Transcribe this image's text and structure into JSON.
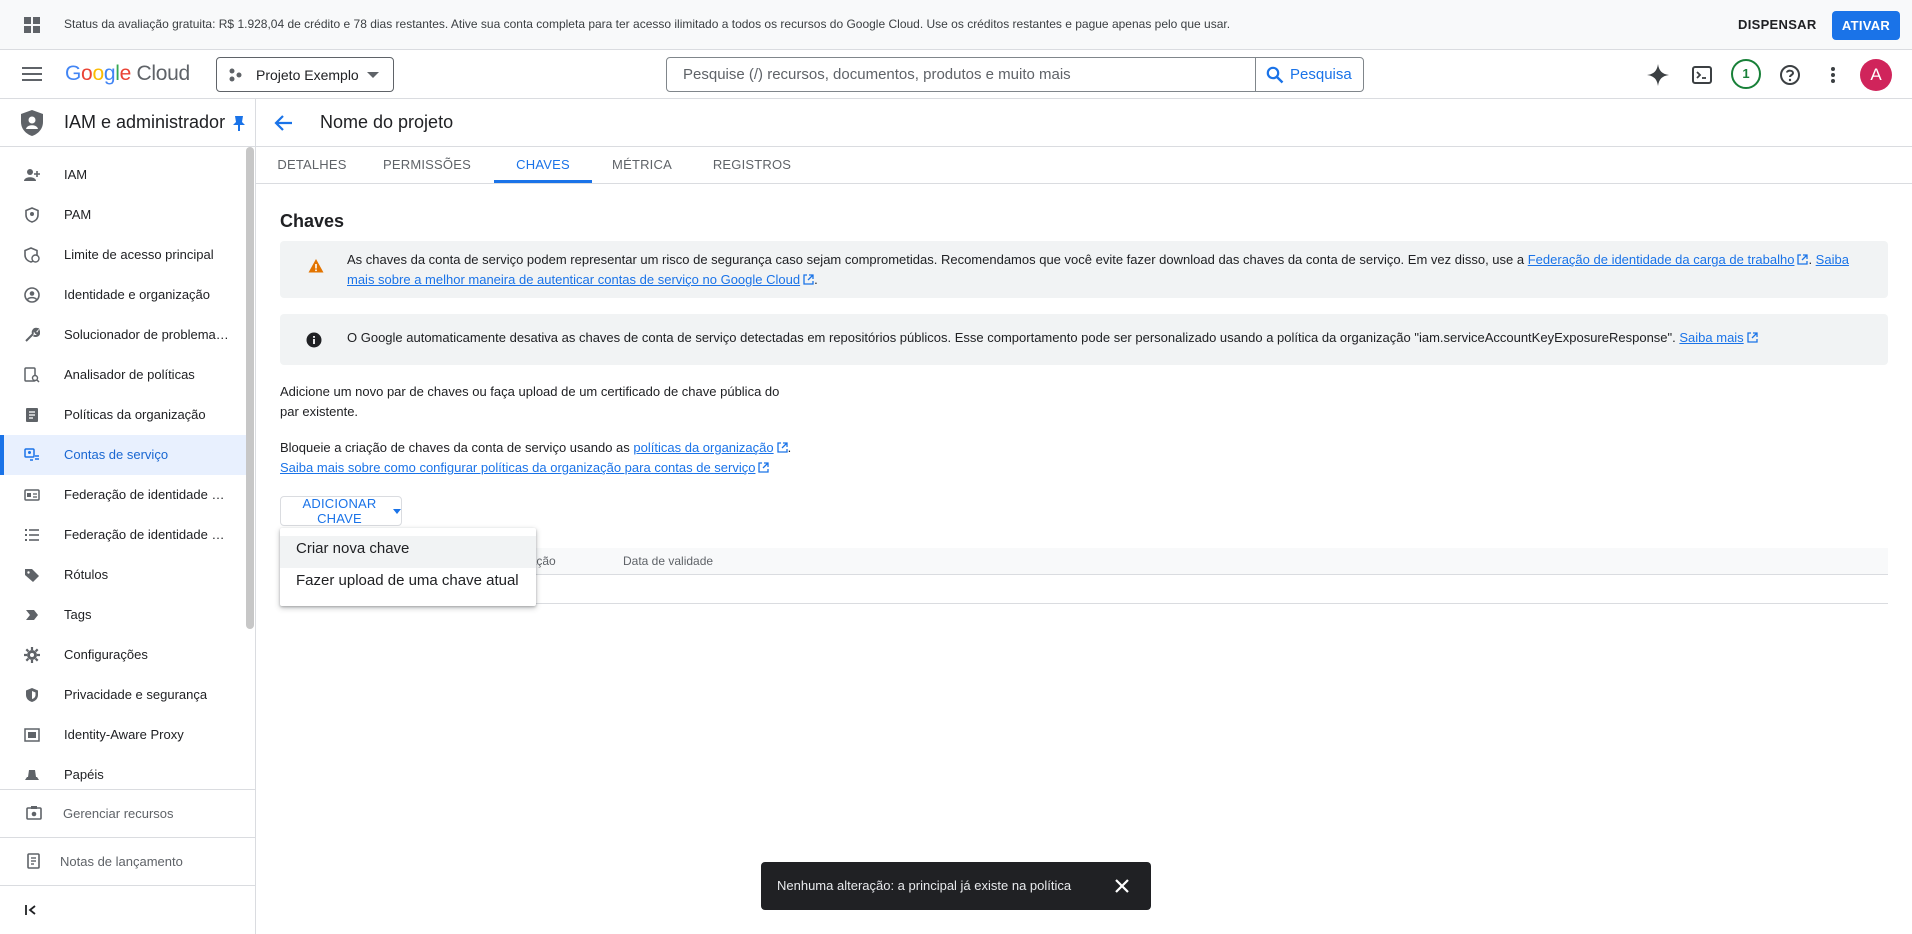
{
  "banner": {
    "text": "Status da avaliação gratuita: R$ 1.928,04 de crédito e 78 dias restantes. Ative sua conta completa para ter acesso ilimitado a todos os recursos do Google Cloud. Use os créditos restantes e pague apenas pelo que usar.",
    "dismiss_label": "DISPENSAR",
    "activate_label": "ATIVAR"
  },
  "header": {
    "logo_google": "Google",
    "logo_cloud": "Cloud",
    "project_name": "Projeto Exemplo",
    "search_placeholder": "Pesquise (/) recursos, documentos, produtos e muito mais",
    "search_button": "Pesquisa",
    "notification_count": "1",
    "avatar_initial": "A"
  },
  "sidebar": {
    "title": "IAM e administrador",
    "items": [
      {
        "label": "IAM",
        "icon": "person-add-icon"
      },
      {
        "label": "PAM",
        "icon": "shield-key-icon"
      },
      {
        "label": "Limite de acesso principal",
        "icon": "shield-clock-icon"
      },
      {
        "label": "Identidade e organização",
        "icon": "account-circle-icon"
      },
      {
        "label": "Solucionador de problemas de política",
        "icon": "wrench-icon"
      },
      {
        "label": "Analisador de políticas",
        "icon": "policy-search-icon"
      },
      {
        "label": "Políticas da organização",
        "icon": "document-icon"
      },
      {
        "label": "Contas de serviço",
        "icon": "service-account-icon",
        "active": true
      },
      {
        "label": "Federação de identidade da carga de trabalho",
        "icon": "id-card-icon"
      },
      {
        "label": "Federação de identidade da força de trabalho",
        "icon": "list-icon"
      },
      {
        "label": "Rótulos",
        "icon": "label-icon"
      },
      {
        "label": "Tags",
        "icon": "tag-arrow-icon"
      },
      {
        "label": "Configurações",
        "icon": "gear-icon"
      },
      {
        "label": "Privacidade e segurança",
        "icon": "privacy-shield-icon"
      },
      {
        "label": "Identity-Aware Proxy",
        "icon": "proxy-icon"
      },
      {
        "label": "Papéis",
        "icon": "hat-icon"
      }
    ],
    "manage_resources": "Gerenciar recursos",
    "release_notes": "Notas de lançamento"
  },
  "main": {
    "page_title": "Nome do projeto",
    "tabs": [
      "DETALHES",
      "PERMISSÕES",
      "CHAVES",
      "MÉTRICA",
      "REGISTROS"
    ],
    "active_tab": "CHAVES",
    "section_title": "Chaves",
    "warning": {
      "text_before": "As chaves da conta de serviço podem representar um risco de segurança caso sejam comprometidas. Recomendamos que você evite fazer download das chaves da conta de serviço. Em vez disso, use a ",
      "link1": "Federação de identidade da carga de trabalho",
      "sep": ". ",
      "link2": "Saiba mais sobre a melhor maneira de autenticar contas de serviço no Google Cloud",
      "end": "."
    },
    "info": {
      "text": "O Google automaticamente desativa as chaves de conta de serviço detectadas em repositórios públicos. Esse comportamento pode ser personalizado usando a política da organização \"iam.serviceAccountKeyExposureResponse\". ",
      "link": "Saiba mais"
    },
    "para1": "Adicione um novo par de chaves ou faça upload de um certificado de chave pública do par existente.",
    "para2": {
      "text": "Bloqueie a criação de chaves da conta de serviço usando as ",
      "link1": "políticas da organização",
      "end": ".",
      "link2": "Saiba mais sobre como configurar políticas da organização para contas de serviço"
    },
    "add_key_button": "ADICIONAR CHAVE",
    "table_columns": [
      "criação",
      "Data de validade"
    ],
    "menu_items": [
      "Criar nova chave",
      "Fazer upload de uma chave atual"
    ]
  },
  "snackbar": {
    "text": "Nenhuma alteração: a principal já existe na política"
  },
  "colors": {
    "accent": "#1a73e8",
    "active_bg": "#e8f0fe",
    "warning_icon": "#e37400",
    "notification": "#188038",
    "avatar_bg": "#d0245b"
  }
}
